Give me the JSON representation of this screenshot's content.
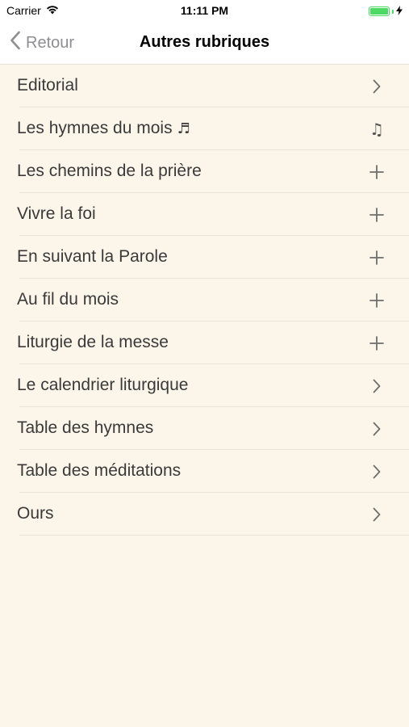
{
  "status_bar": {
    "carrier": "Carrier",
    "time": "11:11 PM",
    "battery_level": 1.0,
    "battery_color": "#4cd964"
  },
  "nav": {
    "back_label": "Retour",
    "title": "Autres rubriques"
  },
  "colors": {
    "background": "#fcf6ea",
    "bar_background": "#ffffff",
    "separator": "#ebe5d6",
    "back_tint": "#8e8e93"
  },
  "rows": [
    {
      "label": "Editorial",
      "accessory": "chevron-right-icon"
    },
    {
      "label": "Les hymnes du mois",
      "inline_icon": "music-note-icon",
      "accessory": "music-notes-icon"
    },
    {
      "label": "Les chemins de la prière",
      "accessory": "plus-icon"
    },
    {
      "label": "Vivre la foi",
      "accessory": "plus-icon"
    },
    {
      "label": "En suivant la Parole",
      "accessory": "plus-icon"
    },
    {
      "label": "Au fil du mois",
      "accessory": "plus-icon"
    },
    {
      "label": "Liturgie de la messe",
      "accessory": "plus-icon"
    },
    {
      "label": "Le calendrier liturgique",
      "accessory": "chevron-right-icon"
    },
    {
      "label": "Table des hymnes",
      "accessory": "chevron-right-icon"
    },
    {
      "label": "Table des méditations",
      "accessory": "chevron-right-icon"
    },
    {
      "label": "Ours",
      "accessory": "chevron-right-icon"
    }
  ]
}
